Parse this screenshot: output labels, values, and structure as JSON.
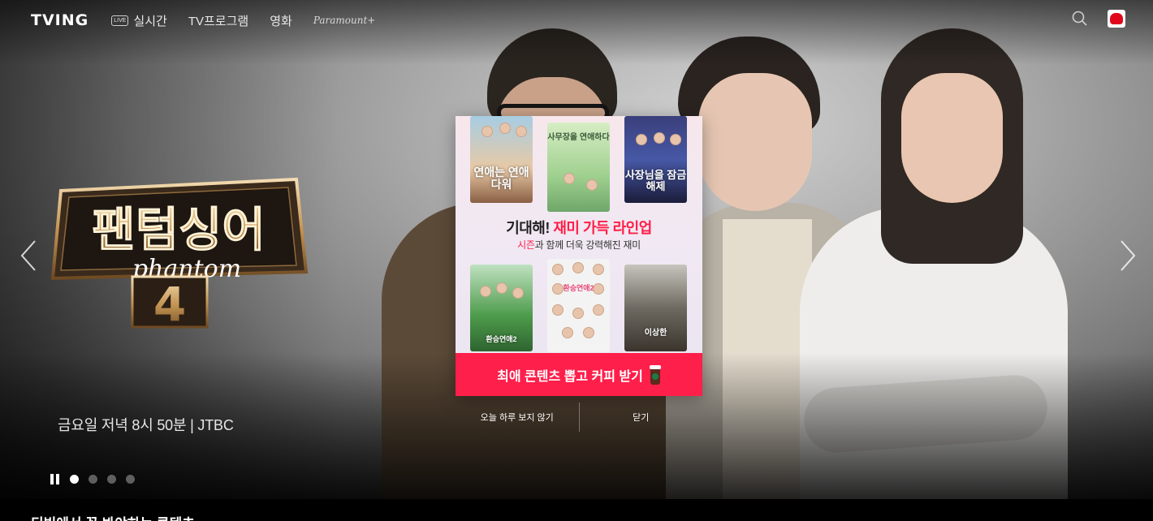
{
  "header": {
    "logo": "TVING",
    "nav": [
      {
        "label": "실시간",
        "badge": "LIVE"
      },
      {
        "label": "TV프로그램"
      },
      {
        "label": "영화"
      },
      {
        "label": "Paramount+"
      }
    ]
  },
  "hero": {
    "show_title": "팬텀싱어",
    "show_subtitle": "phantom",
    "season": "4",
    "schedule": "금요일 저녁 8시 50분 | JTBC",
    "slides_total": 4,
    "active_slide": 1
  },
  "popup": {
    "headline_plain": "기대해! ",
    "headline_highlight": "재미 가득 라인업",
    "subline_highlight": "시즌",
    "subline_rest": "과 함께 더욱 강력해진 재미",
    "posters": [
      {
        "title": "연애는 연애다워"
      },
      {
        "title": "사무장을 연애하다"
      },
      {
        "title": "사장님을 잠금해제"
      },
      {
        "title": "환승연애2"
      },
      {
        "title": "환승연애2"
      },
      {
        "title": "이상한"
      }
    ],
    "cta": "최애 콘텐츠 뽑고 커피 받기",
    "dismiss_today": "오늘 하루 보지 않기",
    "close": "닫기"
  },
  "section": {
    "title": "티빙에서 꼭 봐야하는 콘텐츠"
  },
  "colors": {
    "accent": "#ff1f4b",
    "logo_red": "#e2061a"
  }
}
